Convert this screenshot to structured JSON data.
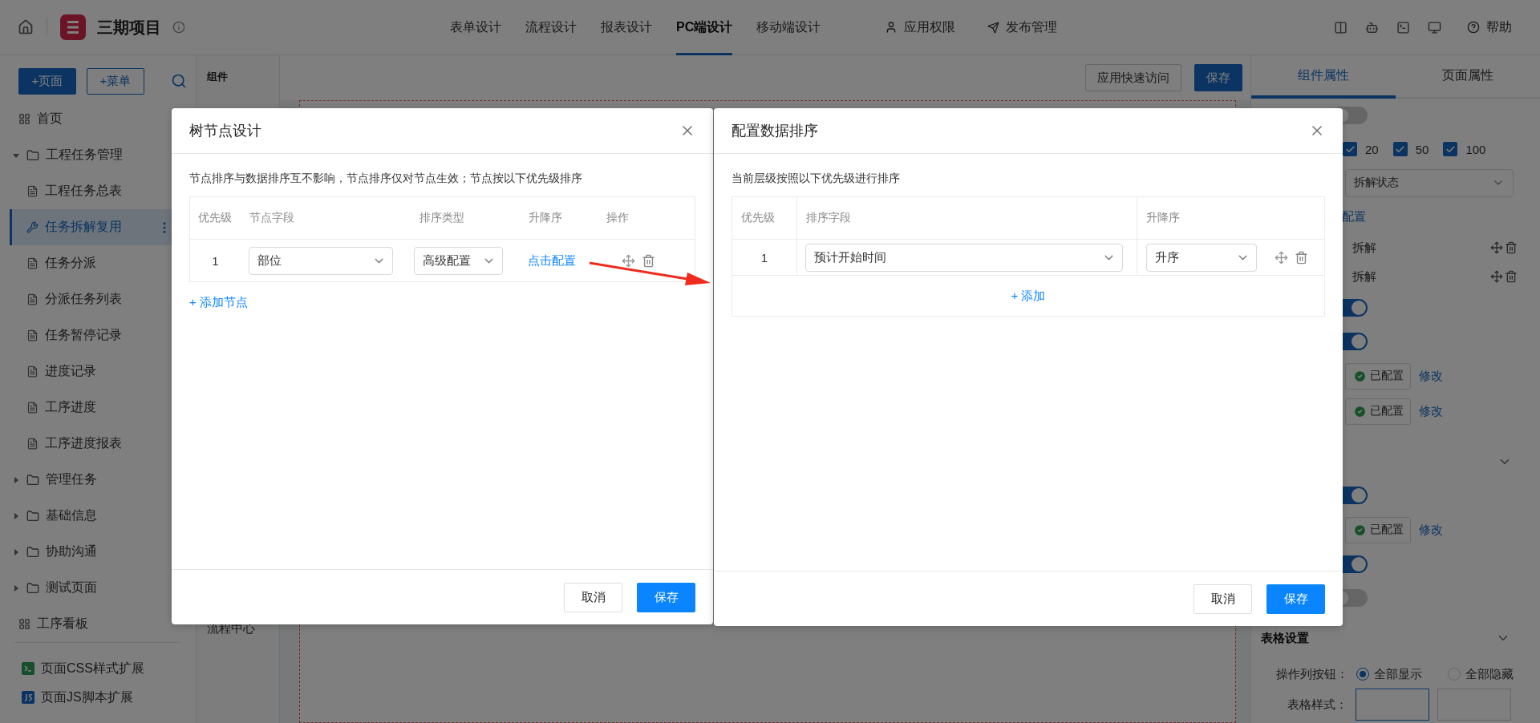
{
  "topbar": {
    "title": "三期项目",
    "tabs": [
      {
        "label": "表单设计",
        "selected": false
      },
      {
        "label": "流程设计",
        "selected": false
      },
      {
        "label": "报表设计",
        "selected": false
      },
      {
        "label": "PC端设计",
        "selected": true
      },
      {
        "label": "移动端设计",
        "selected": false
      }
    ],
    "actions": [
      {
        "label": "应用权限",
        "kind": "user"
      },
      {
        "label": "发布管理",
        "kind": "send"
      }
    ],
    "help": "帮助"
  },
  "sidebar": {
    "buttons": [
      "+页面",
      "+菜单"
    ],
    "items": [
      {
        "label": "首页",
        "kind": "grid"
      },
      {
        "label": "工程任务管理",
        "kind": "folder",
        "expanded": true,
        "children": [
          {
            "label": "工程任务总表",
            "selected": false
          },
          {
            "label": "任务拆解复用",
            "selected": true
          },
          {
            "label": "任务分派",
            "selected": false
          },
          {
            "label": "分派任务列表",
            "selected": false
          },
          {
            "label": "任务暂停记录",
            "selected": false
          },
          {
            "label": "进度记录",
            "selected": false
          },
          {
            "label": "工序进度",
            "selected": false
          },
          {
            "label": "工序进度报表",
            "selected": false
          }
        ]
      },
      {
        "label": "管理任务",
        "kind": "folder",
        "expanded": false
      },
      {
        "label": "基础信息",
        "kind": "folder",
        "expanded": false
      },
      {
        "label": "协助沟通",
        "kind": "folder",
        "expanded": false
      },
      {
        "label": "测试页面",
        "kind": "folder",
        "expanded": false
      },
      {
        "label": "工序看板",
        "kind": "grid"
      }
    ],
    "extensions": [
      {
        "label": "页面CSS样式扩展",
        "kind": "css"
      },
      {
        "label": "页面JS脚本扩展",
        "kind": "js"
      }
    ]
  },
  "components": {
    "title": "组件",
    "footer": "流程中心"
  },
  "canvas": {
    "buttons": [
      "应用快速访问",
      "保存"
    ]
  },
  "props": {
    "tabs": [
      {
        "label": "组件属性",
        "selected": true
      },
      {
        "label": "页面属性",
        "selected": false
      }
    ],
    "rows": [
      {
        "kind": "toggle",
        "on": false
      },
      {
        "kind": "checks",
        "items": [
          {
            "label": "20",
            "checked": true
          },
          {
            "label": "50",
            "checked": true
          },
          {
            "label": "100",
            "checked": true
          }
        ]
      },
      {
        "kind": "select",
        "value": "拆解状态"
      },
      {
        "kind": "link",
        "text": "配置"
      },
      {
        "kind": "option",
        "text": "拆解"
      },
      {
        "kind": "option",
        "text": "拆解"
      },
      {
        "kind": "toggle",
        "on": true
      },
      {
        "kind": "toggle",
        "on": true
      },
      {
        "kind": "status",
        "text": "已配置",
        "link": "修改"
      },
      {
        "kind": "status",
        "text": "已配置",
        "link": "修改"
      },
      {
        "kind": "chevron"
      },
      {
        "kind": "toggle",
        "on": true
      },
      {
        "kind": "status",
        "text": "已配置",
        "link": "修改"
      },
      {
        "kind": "toggle",
        "on": true
      },
      {
        "kind": "toggle",
        "on": false
      },
      {
        "kind": "section",
        "text": "表格设置"
      },
      {
        "kind": "radio",
        "label": "操作列按钮：",
        "options": [
          {
            "label": "全部显示",
            "selected": true
          },
          {
            "label": "全部隐藏",
            "selected": false
          }
        ]
      },
      {
        "kind": "style",
        "label": "表格样式："
      }
    ]
  },
  "tree_modal": {
    "title": "树节点设计",
    "description": "节点排序与数据排序互不影响，节点排序仅对节点生效；节点按以下优先级排序",
    "columns": [
      "优先级",
      "节点字段",
      "排序类型",
      "升降序",
      "操作"
    ],
    "rows": [
      {
        "priority": "1",
        "field": "部位",
        "sort_type": "高级配置",
        "order_link": "点击配置"
      }
    ],
    "add": "+ 添加节点",
    "cancel": "取消",
    "save": "保存"
  },
  "sort_modal": {
    "title": "配置数据排序",
    "description": "当前层级按照以下优先级进行排序",
    "columns": [
      "优先级",
      "排序字段",
      "升降序"
    ],
    "rows": [
      {
        "priority": "1",
        "field": "预计开始时间",
        "order": "升序"
      }
    ],
    "add": "+ 添加",
    "cancel": "取消",
    "save": "保存"
  }
}
